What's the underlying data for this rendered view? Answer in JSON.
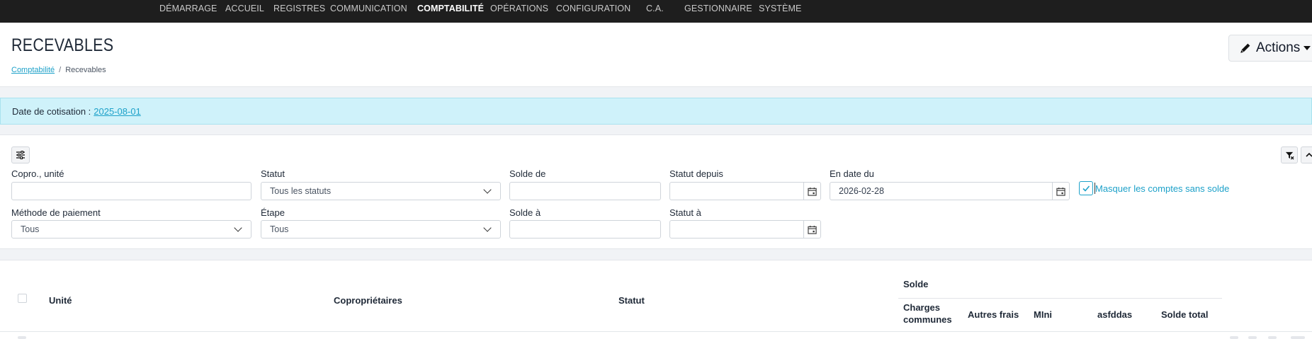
{
  "nav": {
    "items": [
      "DÉMARRAGE",
      "ACCUEIL",
      "REGISTRES",
      "COMMUNICATION",
      "COMPTABILITÉ",
      "OPÉRATIONS",
      "CONFIGURATION",
      "C.A.",
      "GESTIONNAIRE",
      "SYSTÈME"
    ],
    "active": "COMPTABILITÉ"
  },
  "header": {
    "title": "RECEVABLES",
    "breadcrumb": {
      "parent": "Comptabilité",
      "separator": "/",
      "current": "Recevables"
    },
    "actions_label": "Actions",
    "actions_icon": "pencil-icon"
  },
  "banner": {
    "label": "Date de cotisation :",
    "date": "2025-08-01"
  },
  "filters": {
    "copro_label": "Copro., unité",
    "copro_value": "",
    "statut_label": "Statut",
    "statut_value": "Tous les statuts",
    "solde_de_label": "Solde de",
    "solde_de_value": "",
    "statut_depuis_label": "Statut depuis",
    "statut_depuis_value": "",
    "en_date_du_label": "En date du",
    "en_date_du_value": "2026-02-28",
    "masquer_label": "Masquer les comptes sans solde",
    "masquer_checked": true,
    "methode_label": "Méthode de paiement",
    "methode_value": "Tous",
    "etape_label": "Étape",
    "etape_value": "Tous",
    "solde_a_label": "Solde à",
    "solde_a_value": "",
    "statut_a_label": "Statut à",
    "statut_a_value": ""
  },
  "table": {
    "columns": {
      "unite": "Unité",
      "coproprietaires": "Copropriétaires",
      "statut": "Statut",
      "solde_group": "Solde",
      "charges_communes_1": "Charges",
      "charges_communes_2": "communes",
      "autres_frais": "Autres frais",
      "mini": "MIni",
      "asfddas": "asfddas",
      "solde_total": "Solde total"
    }
  },
  "colors": {
    "accent": "#1da1c9",
    "nav_bg": "#1e1e1e",
    "banner_bg": "#cff2fa"
  }
}
